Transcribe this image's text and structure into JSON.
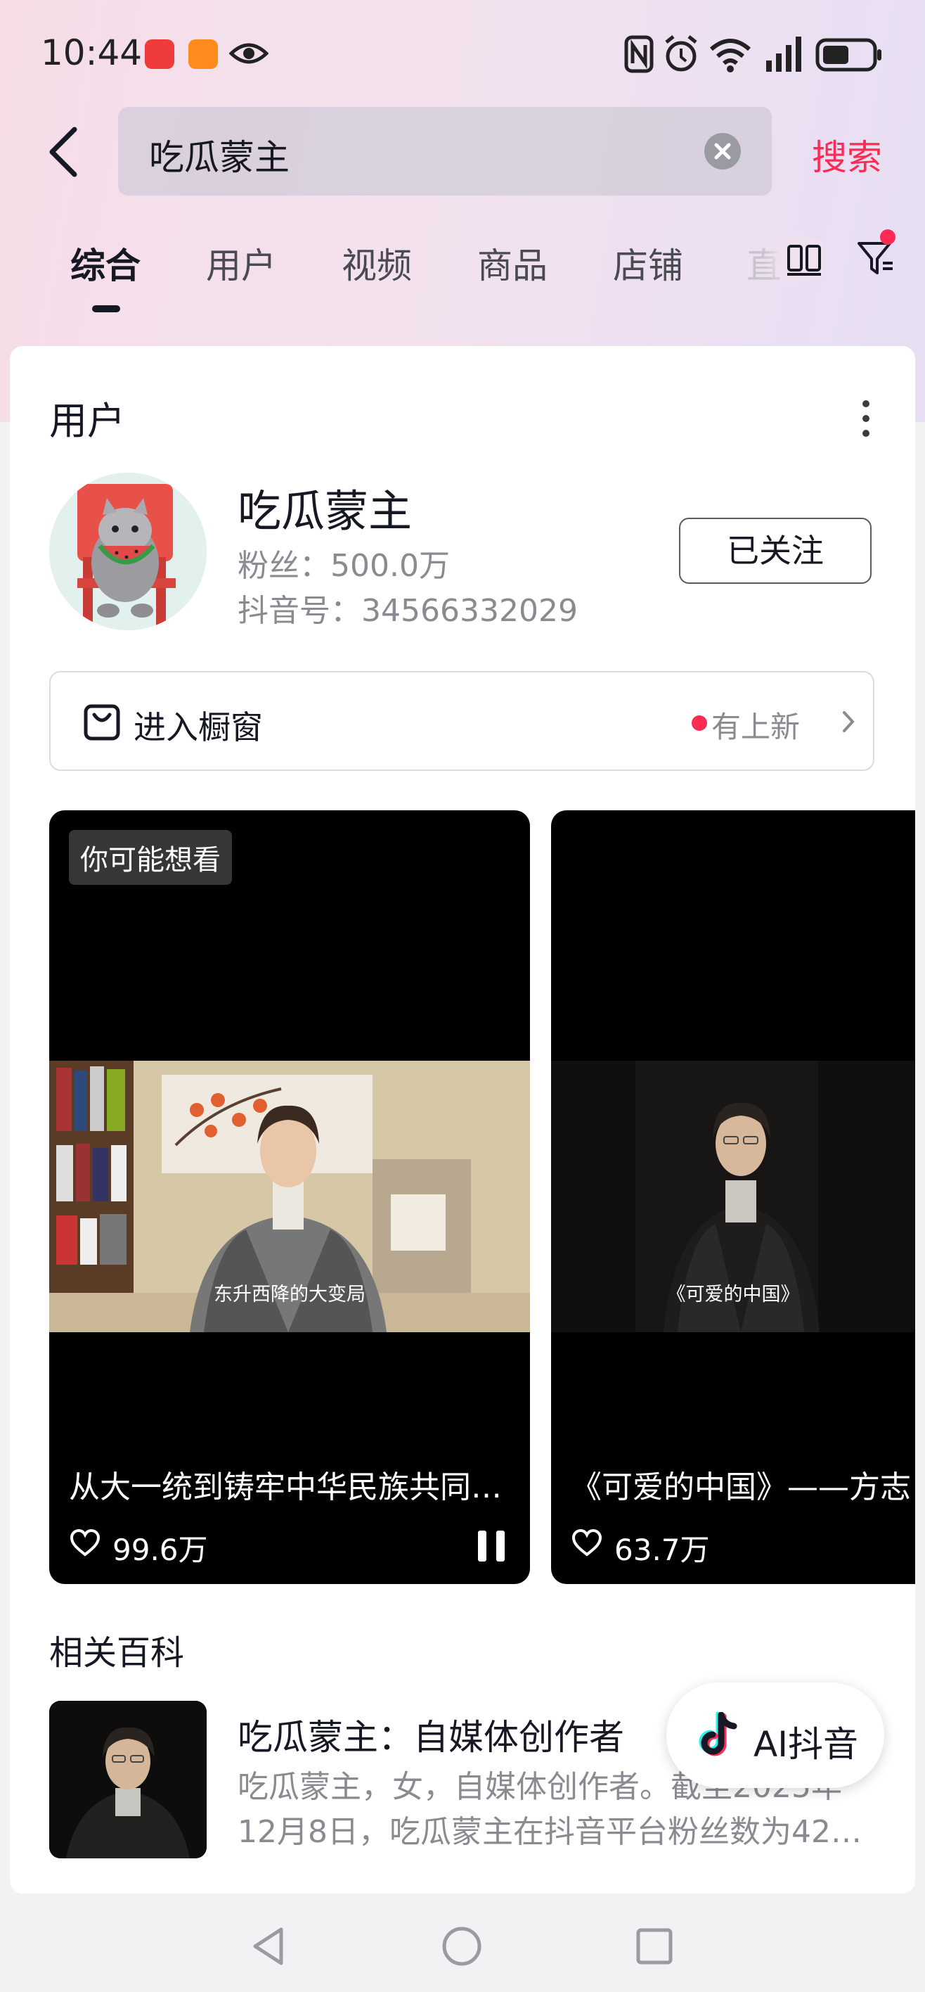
{
  "status_bar": {
    "time": "10:44",
    "icons": [
      "red-notification-icon",
      "orange-app-icon",
      "eye-icon",
      "nfc-icon",
      "alarm-icon",
      "wifi-icon",
      "signal-icon",
      "battery-icon"
    ]
  },
  "search": {
    "query": "吃瓜蒙主",
    "button_label": "搜索"
  },
  "tabs": [
    {
      "label": "综合",
      "active": true
    },
    {
      "label": "用户",
      "active": false
    },
    {
      "label": "视频",
      "active": false
    },
    {
      "label": "商品",
      "active": false
    },
    {
      "label": "店铺",
      "active": false
    },
    {
      "label": "直",
      "active": false
    }
  ],
  "user_section": {
    "title": "用户",
    "name": "吃瓜蒙主",
    "fans": "粉丝：500.0万",
    "douyin_id": "抖音号：34566332029",
    "follow_label": "已关注"
  },
  "shop_row": {
    "label": "进入橱窗",
    "status": "有上新"
  },
  "videos": [
    {
      "badge": "你可能想看",
      "caption": "东升西降的大变局",
      "title": "从大一统到铸牢中华民族共同…",
      "likes": "99.6万"
    },
    {
      "badge": "",
      "caption": "《可爱的中国》",
      "title": "《可爱的中国》——方志",
      "likes": "63.7万"
    }
  ],
  "wiki": {
    "section_title": "相关百科",
    "name": "吃瓜蒙主：自媒体创作者",
    "desc_line1": "吃瓜蒙主，女，自媒体创作者。截至2025年",
    "desc_line2": "12月8日，吃瓜蒙主在抖音平台粉丝数为42…"
  },
  "ai_button": {
    "label": "AI抖音"
  },
  "colors": {
    "accent": "#fe2c55",
    "text": "#161823",
    "secondary": "#8a8b91"
  }
}
